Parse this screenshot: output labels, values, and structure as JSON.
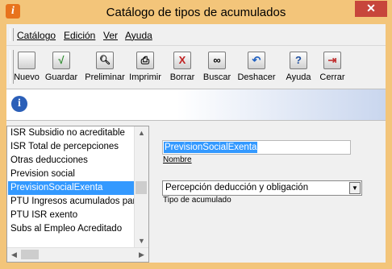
{
  "window": {
    "title": "Catálogo de tipos de acumulados",
    "app_icon_glyph": "i",
    "close_glyph": "✕"
  },
  "menu": [
    {
      "label": "Catálogo"
    },
    {
      "label": "Edición"
    },
    {
      "label": "Ver"
    },
    {
      "label": "Ayuda"
    }
  ],
  "toolbar": [
    {
      "label": "Nuevo",
      "icon": "new-document-icon",
      "glyph": "",
      "color": "#6a6a6a"
    },
    {
      "label": "Guardar",
      "icon": "checkmark-icon",
      "glyph": "√",
      "color": "#2e8b2e"
    },
    {
      "label": "Preliminar",
      "icon": "preview-magnifier-icon",
      "glyph": "🔍︎",
      "color": "#404040"
    },
    {
      "label": "Imprimir",
      "icon": "printer-icon",
      "glyph": "⎙",
      "color": "#404040"
    },
    {
      "label": "Borrar",
      "icon": "delete-x-icon",
      "glyph": "X",
      "color": "#c02020"
    },
    {
      "label": "Buscar",
      "icon": "binoculars-icon",
      "glyph": "∞",
      "color": "#202020"
    },
    {
      "label": "Deshacer",
      "icon": "undo-arrow-icon",
      "glyph": "↶",
      "color": "#2060c0"
    },
    {
      "label": "Ayuda",
      "icon": "help-question-icon",
      "glyph": "?",
      "color": "#2050a0"
    },
    {
      "label": "Cerrar",
      "icon": "exit-door-icon",
      "glyph": "⇥",
      "color": "#c03030"
    }
  ],
  "info": {
    "icon": "info-icon",
    "glyph": "i"
  },
  "list": {
    "items": [
      "ISR Subsidio no acreditable",
      "ISR Total de percepciones",
      "Otras deducciones",
      "Prevision social",
      "PrevisionSocialExenta",
      "PTU Ingresos acumulados para",
      "PTU ISR exento",
      "Subs al Empleo  Acreditado"
    ],
    "selected_index": 4
  },
  "form": {
    "nombre_value": "PrevisionSocialExenta",
    "nombre_label": "Nombre",
    "tipo_value": "Percepción deducción y obligación",
    "tipo_label": "Tipo de acumulado"
  },
  "colors": {
    "title_bg": "#f3c57a",
    "selection": "#3399ff",
    "close": "#c7463b"
  }
}
